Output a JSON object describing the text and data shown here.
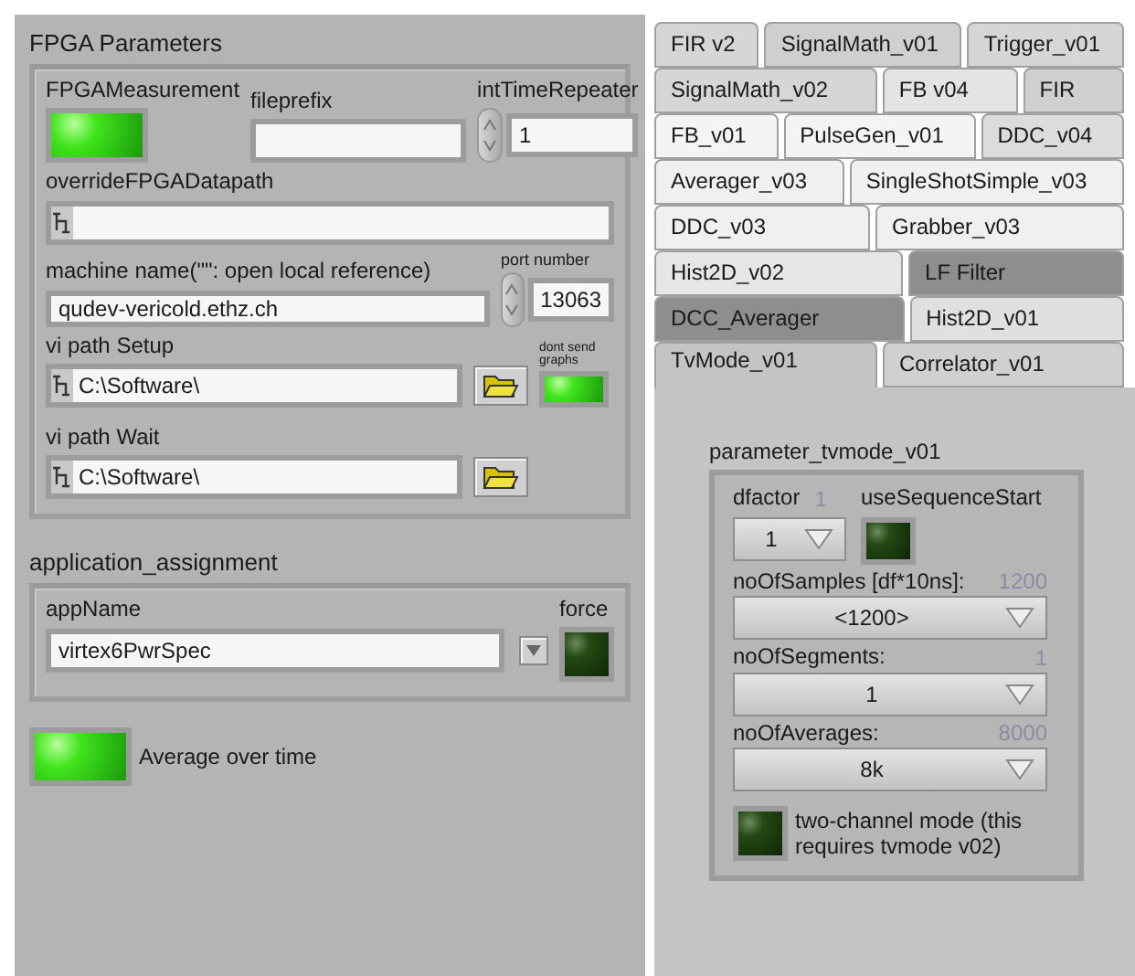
{
  "fpga_parameters": {
    "title": "FPGA Parameters",
    "fpga_measurement": {
      "label": "FPGAMeasurement",
      "on": true
    },
    "fileprefix": {
      "label": "fileprefix"
    },
    "int_time_repeater": {
      "label": "intTimeRepeater",
      "value": "1"
    },
    "override_fpga_datapath": {
      "label": "overrideFPGADatapath"
    },
    "machine_name": {
      "label": "machine name(\"\":  open local reference)",
      "value": "qudev-vericold.ethz.ch"
    },
    "port_number": {
      "label": "port number",
      "value": "13063"
    },
    "vi_path_setup": {
      "label": "vi path Setup",
      "value": "C:\\Software\\"
    },
    "dont_send_graphs": {
      "label": "dont send graphs",
      "on": true
    },
    "vi_path_wait": {
      "label": "vi path Wait",
      "value": "C:\\Software\\"
    }
  },
  "application_assignment": {
    "title": "application_assignment",
    "app_name": {
      "label": "appName",
      "value": "virtex6PwrSpec"
    },
    "force": {
      "label": "force",
      "on": false
    }
  },
  "average_over_time": {
    "label": "Average over time",
    "on": true
  },
  "tab_rows": [
    [
      {
        "label": "FIR v2",
        "selected": false,
        "color": "#d6d6d6"
      },
      {
        "label": "SignalMath_v01",
        "selected": false,
        "color": "#cfcfcf"
      },
      {
        "label": "Trigger_v01",
        "selected": false,
        "color": "#d6d6d6"
      }
    ],
    [
      {
        "label": "SignalMath_v02",
        "selected": false,
        "color": "#d6d6d6"
      },
      {
        "label": "FB v04",
        "selected": false,
        "color": "#e4e4e4"
      },
      {
        "label": "FIR",
        "selected": false,
        "color": "#cfcfcf"
      }
    ],
    [
      {
        "label": "FB_v01",
        "selected": false,
        "color": "#f4f4f4"
      },
      {
        "label": "PulseGen_v01",
        "selected": false,
        "color": "#f4f4f4"
      },
      {
        "label": "DDC_v04",
        "selected": false,
        "color": "#dcdcdc"
      }
    ],
    [
      {
        "label": "Averager_v03",
        "selected": false,
        "color": "#f0f0f0"
      },
      {
        "label": "SingleShotSimple_v03",
        "selected": false,
        "color": "#f0f0f0"
      }
    ],
    [
      {
        "label": "DDC_v03",
        "selected": false,
        "color": "#f0f0f0"
      },
      {
        "label": "Grabber_v03",
        "selected": false,
        "color": "#f0f0f0"
      }
    ],
    [
      {
        "label": "Hist2D_v02",
        "selected": false,
        "color": "#e6e6e6"
      },
      {
        "label": "LF Filter",
        "selected": false,
        "color": "#8e8e8e"
      }
    ],
    [
      {
        "label": "DCC_Averager",
        "selected": false,
        "color": "#8e8e8e"
      },
      {
        "label": "Hist2D_v01",
        "selected": false,
        "color": "#e0e0e0"
      }
    ],
    [
      {
        "label": "TvMode_v01",
        "selected": true,
        "color": "#c4c4c4"
      },
      {
        "label": "Correlator_v01",
        "selected": false,
        "color": "#d0d0d0"
      }
    ]
  ],
  "tv_mode": {
    "title": "parameter_tvmode_v01",
    "dfactor": {
      "label": "dfactor",
      "reading": "1",
      "value": "1"
    },
    "use_sequence_start": {
      "label": "useSequenceStart",
      "on": false
    },
    "samples": {
      "label": "noOfSamples [df*10ns]:",
      "reading": "1200",
      "value": "<1200>"
    },
    "segments": {
      "label": "noOfSegments:",
      "reading": "1",
      "value": "1"
    },
    "averages": {
      "label": "noOfAverages:",
      "reading": "8000",
      "value": "8k"
    },
    "two_channel": {
      "label": "two-channel mode (this requires tvmode v02)",
      "on": false
    }
  }
}
